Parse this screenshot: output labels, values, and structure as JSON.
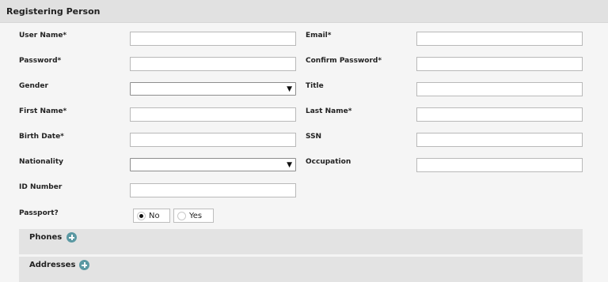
{
  "header": {
    "title": "Registering Person"
  },
  "fields": {
    "user_name": {
      "label": "User Name*",
      "value": ""
    },
    "email": {
      "label": "Email*",
      "value": ""
    },
    "password": {
      "label": "Password*",
      "value": ""
    },
    "confirm_password": {
      "label": "Confirm Password*",
      "value": ""
    },
    "gender": {
      "label": "Gender",
      "value": ""
    },
    "title": {
      "label": "Title",
      "value": ""
    },
    "first_name": {
      "label": "First Name*",
      "value": ""
    },
    "last_name": {
      "label": "Last Name*",
      "value": ""
    },
    "birth_date": {
      "label": "Birth Date*",
      "value": ""
    },
    "ssn": {
      "label": "SSN",
      "value": ""
    },
    "nationality": {
      "label": "Nationality",
      "value": ""
    },
    "occupation": {
      "label": "Occupation",
      "value": ""
    },
    "id_number": {
      "label": "ID Number",
      "value": ""
    },
    "passport": {
      "label": "Passport?",
      "options": [
        "No",
        "Yes"
      ],
      "selected": "No"
    }
  },
  "select_arrow": "▼",
  "sections": {
    "phones": {
      "label": "Phones",
      "icon": "plus-icon",
      "color": "#5a98a2"
    },
    "addresses": {
      "label": "Addresses",
      "icon": "plus-icon",
      "color": "#5a98a2"
    }
  }
}
